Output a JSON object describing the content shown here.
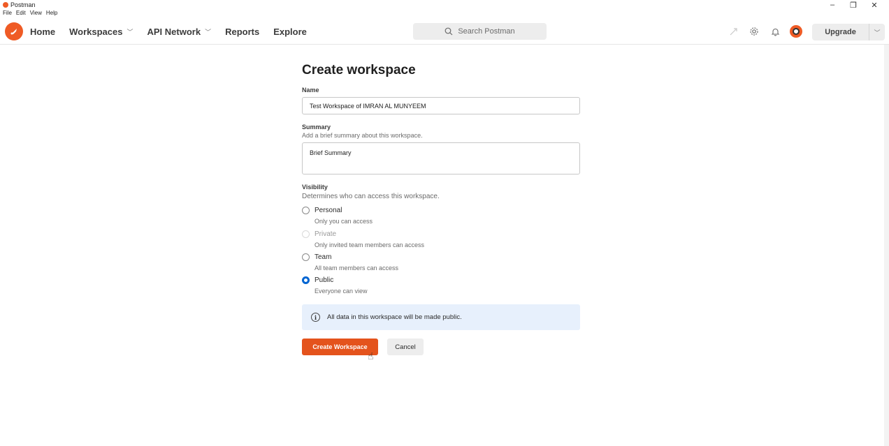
{
  "window": {
    "app_title": "Postman",
    "menu": [
      "File",
      "Edit",
      "View",
      "Help"
    ],
    "controls": {
      "minimize": "–",
      "restore": "❐",
      "close": "✕"
    }
  },
  "header": {
    "nav": {
      "home": "Home",
      "workspaces": "Workspaces",
      "api_network": "API Network",
      "reports": "Reports",
      "explore": "Explore"
    },
    "search_placeholder": "Search Postman",
    "upgrade_label": "Upgrade",
    "icons": [
      "invite-icon",
      "settings-gear-icon",
      "notifications-bell-icon",
      "avatar"
    ]
  },
  "form": {
    "title": "Create workspace",
    "name": {
      "label": "Name",
      "value": "Test Workspace of IMRAN AL MUNYEEM"
    },
    "summary": {
      "label": "Summary",
      "hint": "Add a brief summary about this workspace.",
      "placeholder": "Brief Summary"
    },
    "visibility": {
      "label": "Visibility",
      "hint": "Determines who can access this workspace.",
      "options": [
        {
          "label": "Personal",
          "desc": "Only you can access",
          "selected": false,
          "disabled": false
        },
        {
          "label": "Private",
          "desc": "Only invited team members can access",
          "selected": false,
          "disabled": true
        },
        {
          "label": "Team",
          "desc": "All team members can access",
          "selected": false,
          "disabled": false
        },
        {
          "label": "Public",
          "desc": "Everyone can view",
          "selected": true,
          "disabled": false
        }
      ]
    },
    "info_message": "All data in this workspace will be made public.",
    "create_button": "Create Workspace",
    "cancel_button": "Cancel"
  },
  "colors": {
    "brand": "#ef5b25",
    "primary_button": "#e4531c",
    "radio_selected": "#0265d2",
    "info_bg": "#e7f0fc"
  }
}
